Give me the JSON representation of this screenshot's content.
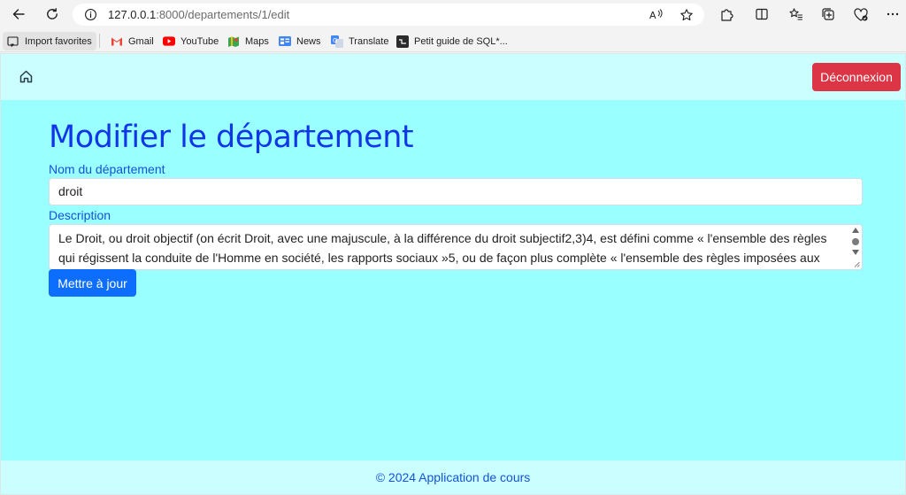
{
  "browser": {
    "url_host": "127.0.0.1",
    "url_path": ":8000/departements/1/edit",
    "bookmarks": [
      {
        "label": "Import favorites",
        "icon": "import-icon"
      },
      {
        "label": "Gmail",
        "icon": "gmail-icon"
      },
      {
        "label": "YouTube",
        "icon": "youtube-icon"
      },
      {
        "label": "Maps",
        "icon": "maps-icon"
      },
      {
        "label": "News",
        "icon": "news-icon"
      },
      {
        "label": "Translate",
        "icon": "translate-icon"
      },
      {
        "label": "Petit guide de SQL*...",
        "icon": "sql-guide-icon"
      }
    ]
  },
  "navbar": {
    "logout_label": "Déconnexion"
  },
  "form": {
    "title": "Modifier le département",
    "name_label": "Nom du département",
    "name_value": "droit",
    "description_label": "Description",
    "description_value": "Le Droit, ou droit objectif (on écrit Droit, avec une majuscule, à la différence du droit subjectif2,3)4, est défini comme « l'ensemble des règles qui régissent la conduite de l'Homme en société, les rapports sociaux »5, ou de façon plus complète « l'ensemble des règles imposées aux membres",
    "submit_label": "Mettre à jour"
  },
  "footer": {
    "text": "© 2024 Application de cours"
  },
  "colors": {
    "page_background": "#99ffff",
    "navbar_background": "#cbffff",
    "logout_button": "#dc3545",
    "primary_button": "#0d6efd",
    "heading": "#1136e8",
    "label": "#1452d6"
  }
}
